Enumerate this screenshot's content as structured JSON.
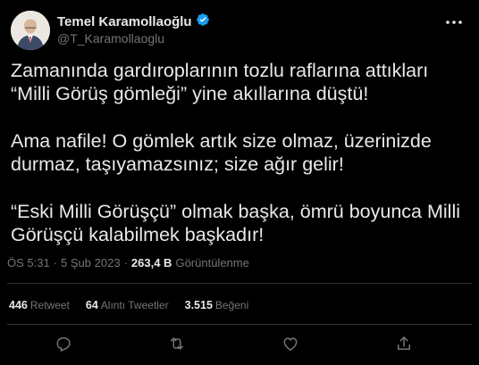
{
  "author": {
    "display_name": "Temel Karamollaoğlu",
    "handle": "@T_Karamollaoglu"
  },
  "tweet": {
    "paragraphs": [
      "Zamanında gardıroplarının tozlu raflarına attıkları\n“Milli Görüş gömleği” yine akıllarına düştü!",
      "Ama nafile! O gömlek artık size olmaz, üzerinizde\ndurmaz, taşıyamazsınız; size ağır gelir!",
      "“Eski Milli Görüşçü” olmak başka, ömrü boyunca Milli\nGörüşçü kalabilmek başkadır!"
    ],
    "time": "ÖS 5:31",
    "separator": "·",
    "date": "5 Şub 2023",
    "views_count": "263,4 B",
    "views_label": "Görüntülenme"
  },
  "stats": {
    "retweets_count": "446",
    "retweets_label": "Retweet",
    "quotes_count": "64",
    "quotes_label": "Alıntı Tweetler",
    "likes_count": "3.515",
    "likes_label": "Beğeni"
  },
  "icons": {
    "verified": "verified-badge-icon",
    "more": "more-options-icon",
    "reply": "reply-icon",
    "retweet": "retweet-icon",
    "like": "like-icon",
    "share": "share-icon"
  },
  "colors": {
    "background": "#000000",
    "text": "#e7e9ea",
    "secondary": "#71767b",
    "verified": "#1d9bf0",
    "divider": "#2f3336"
  }
}
